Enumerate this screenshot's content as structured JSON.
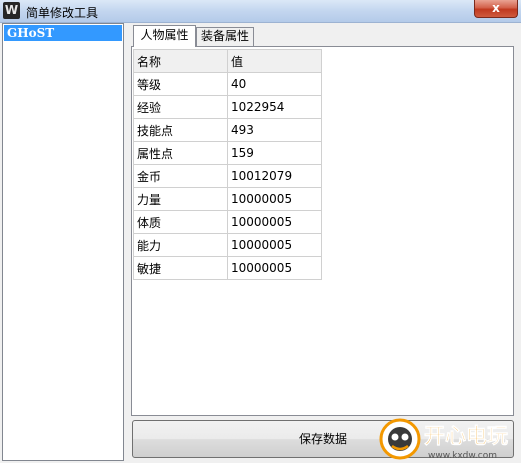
{
  "window": {
    "icon_letter": "W",
    "title": "简单修改工具",
    "close_glyph": "x"
  },
  "characters": [
    {
      "name": "GHoST",
      "selected": true
    }
  ],
  "tabs": [
    {
      "label": "人物属性",
      "active": true
    },
    {
      "label": "装备属性",
      "active": false
    }
  ],
  "table": {
    "headers": [
      "名称",
      "值"
    ],
    "rows": [
      [
        "等级",
        "40"
      ],
      [
        "经验",
        "1022954"
      ],
      [
        "技能点",
        "493"
      ],
      [
        "属性点",
        "159"
      ],
      [
        "金币",
        "10012079"
      ],
      [
        "力量",
        "10000005"
      ],
      [
        "体质",
        "10000005"
      ],
      [
        "能力",
        "10000005"
      ],
      [
        "敏捷",
        "10000005"
      ]
    ]
  },
  "actions": {
    "save_label": "保存数据"
  },
  "watermark": {
    "brand": "开心电玩",
    "url": "www.kxdw.com"
  },
  "colors": {
    "selection": "#3399ff",
    "title_bar": "#c3d6ef",
    "close": "#c0391f",
    "watermark": "#f39800"
  }
}
